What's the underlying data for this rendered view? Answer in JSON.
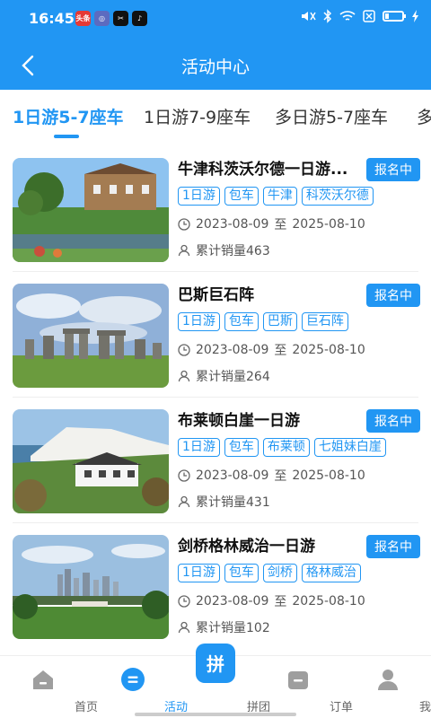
{
  "status_bar": {
    "time": "16:45",
    "apps": [
      {
        "label": "头条",
        "color": "#e53935"
      },
      {
        "label": "◎",
        "color": "#5c6bc0"
      },
      {
        "label": "✂",
        "color": "#111111"
      },
      {
        "label": "♪",
        "color": "#111111"
      }
    ]
  },
  "header": {
    "title": "活动中心"
  },
  "tabs": [
    {
      "label": "1日游5-7座车",
      "active": true
    },
    {
      "label": "1日游7-9座车",
      "active": false
    },
    {
      "label": "多日游5-7座车",
      "active": false
    },
    {
      "label": "多",
      "active": false
    }
  ],
  "items": [
    {
      "title": "牛津科茨沃尔德一日游...",
      "badge": "报名中",
      "tags": [
        "1日游",
        "包车",
        "牛津",
        "科茨沃尔德"
      ],
      "date_start": "2023-08-09",
      "date_sep": "至",
      "date_end": "2025-08-10",
      "sales": "累计销量463"
    },
    {
      "title": "巴斯巨石阵",
      "badge": "报名中",
      "tags": [
        "1日游",
        "包车",
        "巴斯",
        "巨石阵"
      ],
      "date_start": "2023-08-09",
      "date_sep": "至",
      "date_end": "2025-08-10",
      "sales": "累计销量264"
    },
    {
      "title": "布莱顿白崖一日游",
      "badge": "报名中",
      "tags": [
        "1日游",
        "包车",
        "布莱顿",
        "七姐妹白崖"
      ],
      "date_start": "2023-08-09",
      "date_sep": "至",
      "date_end": "2025-08-10",
      "sales": "累计销量431"
    },
    {
      "title": "剑桥格林威治一日游",
      "badge": "报名中",
      "tags": [
        "1日游",
        "包车",
        "剑桥",
        "格林威治"
      ],
      "date_start": "2023-08-09",
      "date_sep": "至",
      "date_end": "2025-08-10",
      "sales": "累计销量102"
    }
  ],
  "bottom_nav": [
    {
      "label": "首页",
      "icon": "home-icon",
      "active": false
    },
    {
      "label": "活动",
      "icon": "activity-icon",
      "active": true
    },
    {
      "label": "拼团",
      "icon": "group-buy-icon",
      "active": false,
      "glyph": "拼"
    },
    {
      "label": "订单",
      "icon": "order-icon",
      "active": false
    },
    {
      "label": "我的",
      "icon": "profile-icon",
      "active": false
    }
  ],
  "colors": {
    "primary": "#2196F3"
  }
}
